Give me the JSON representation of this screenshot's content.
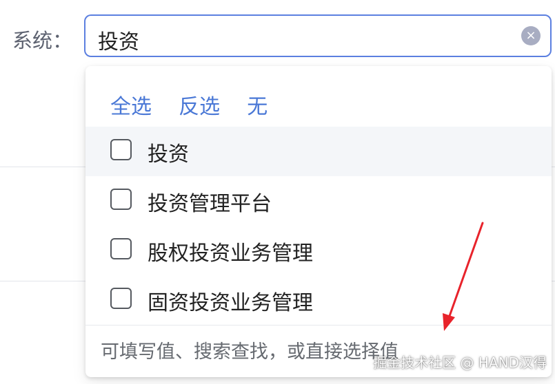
{
  "form": {
    "label": "系统：",
    "input_value": "投资",
    "clear_icon": "×"
  },
  "dropdown": {
    "actions": [
      "全选",
      "反选",
      "无"
    ],
    "options": [
      {
        "label": "投资",
        "checked": false
      },
      {
        "label": "投资管理平台",
        "checked": false
      },
      {
        "label": "股权投资业务管理",
        "checked": false
      },
      {
        "label": "固资投资业务管理",
        "checked": false
      }
    ],
    "hint": "可填写值、搜索查找，或直接选择值"
  },
  "watermark": "掘金技术社区 @ HAND汉得",
  "colors": {
    "accent": "#4a78d6",
    "input_border": "#5b7fe0",
    "arrow": "#e8232b"
  }
}
